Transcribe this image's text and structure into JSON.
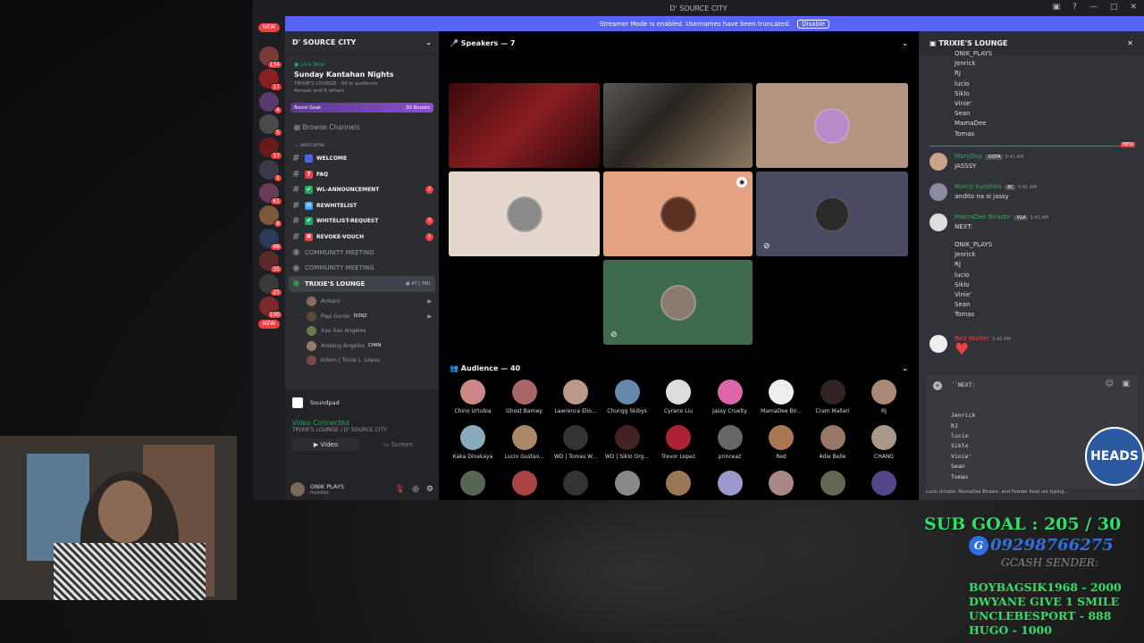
{
  "window": {
    "title": "D' SOURCE CITY"
  },
  "banner": {
    "text": "Streamer Mode is enabled. Usernames have been truncated.",
    "button": "Disable"
  },
  "servers": [
    {
      "badge": "NEW"
    },
    {
      "count": "134"
    },
    {
      "count": "17"
    },
    {
      "count": "4"
    },
    {
      "count": "5"
    },
    {
      "count": "17"
    },
    {
      "count": "1"
    },
    {
      "count": "61"
    },
    {
      "count": "9"
    },
    {
      "count": "48"
    },
    {
      "count": "35"
    },
    {
      "count": "25"
    },
    {
      "count": "100"
    },
    {
      "badge": "NEW"
    }
  ],
  "sidebar": {
    "server_name": "D' SOURCE CITY",
    "event": {
      "live": "Live Now",
      "title": "Sunday Kantahan Nights",
      "lounge": "TRIXIE'S LOUNGE",
      "audience": "40 in audience",
      "others": "Armani and 6 others"
    },
    "boost": {
      "label": "Boost Goal",
      "count": "30 Boosts"
    },
    "browse": "Browse Channels",
    "category": "welcome.",
    "channels": [
      {
        "icon": "🐾",
        "name": "WELCOME",
        "badge": ""
      },
      {
        "icon": "?",
        "name": "FAQ",
        "badge": ""
      },
      {
        "icon": "✔",
        "name": "WL-ANNOUNCEMENT",
        "badge": "2"
      },
      {
        "icon": "✉",
        "name": "REWHITELIST",
        "badge": ""
      },
      {
        "icon": "✔",
        "name": "WHITELIST-REQUEST",
        "badge": "3"
      },
      {
        "icon": "✖",
        "name": "REVOKE-VOUCH",
        "badge": "1"
      }
    ],
    "meetings": [
      "COMMUNITY MEETING",
      "COMMUNITY MEETING"
    ],
    "lounge": {
      "name": "TRIXIE'S LOUNGE",
      "sub": "Sunday Kantahan Nights",
      "count": "47",
      "listeners": "780"
    },
    "users": [
      {
        "name": "Armani",
        "tag": ""
      },
      {
        "name": "Papi Gordo",
        "tag": "DONZ"
      },
      {
        "name": "Xav Xav Angeles",
        "tag": ""
      },
      {
        "name": "Andeng Angeles",
        "tag": "CHRN"
      },
      {
        "name": "Intern | Trixie L. Lopez",
        "tag": ""
      }
    ],
    "soundpad": "Soundpad",
    "voice": {
      "status": "Video Connected",
      "where": "TRIXIE'S LOUNGE / D' SOURCE CITY",
      "video": "Video",
      "screen": "Screen"
    },
    "me": {
      "name": "ONIK PLAYS",
      "status": "Invisible"
    }
  },
  "stage": {
    "speakers_label": "Speakers — 7",
    "audience_label": "Audience — 40",
    "audience": [
      "Chino Urtubia",
      "Ghost Barney",
      "Lawrence Elio...",
      "Chungg Skibys",
      "Cyrano Liu",
      "Jassy Cruelty",
      "MamaDee Bir...",
      "Cram Mallari",
      "RJ",
      "Kaka Dinakaya",
      "Lucio Gustav...",
      "WD | Tomas W...",
      "WD | Siklo Org...",
      "Trevor Lopez",
      "princeaz",
      "Red",
      "Adie Belle",
      "CHANG",
      "",
      "",
      "",
      "",
      "",
      "",
      "",
      "",
      ""
    ]
  },
  "chat": {
    "title": "TRIXIE'S LOUNGE",
    "top_lines": [
      "ONIK_PLAYS",
      "Jenrick",
      "RJ",
      "lucio",
      "Siklo",
      "Vinie'",
      "Sean",
      "MamaDee",
      "Tomas"
    ],
    "new_label": "NEW",
    "messages": [
      {
        "author": "MaryDay",
        "tag": "DOTA",
        "time": "5:41 AM",
        "text": "JASSSY",
        "color": "#3ba55d"
      },
      {
        "author": "Marco kyoshiro",
        "tag": "BC",
        "time": "5:41 AM",
        "text": "andito na si jassy",
        "color": "#3ba55d"
      },
      {
        "author": "MamaDee Birador",
        "tag": "VLA",
        "time": "5:42 AM",
        "text": "NEXT:",
        "color": "#3ba55d"
      },
      {
        "author": "Red Walker",
        "tag": "",
        "time": "5:42 AM",
        "text": "♥",
        "color": "#f23f43"
      }
    ],
    "mama_lines": [
      "ONIK_PLAYS",
      "Jenrick",
      "RJ",
      "lucio",
      "Siklo",
      "Vinie'",
      "Sean",
      "Tomas"
    ],
    "composer": "``NEXT:\n\n\nJenrick\nRJ\nlucio\nSiklo\nVinie'\nSean\nTomas",
    "typing": "Lucio Urtubia, MamaDee Birador, and Powder Kawi are typing..."
  },
  "overlay": {
    "heads": "HEADS",
    "sub_goal": "SUB GOAL : 205 / 30",
    "gcash_number": "09298766275",
    "gcash_sender": "GCASH SENDER:",
    "donors": [
      "BOYBAGSIK1968 - 2000",
      "DWYANE GIVE 1 SMILE",
      "UNCLEBESPORT - 888",
      "HUGO - 1000"
    ]
  },
  "colors": {
    "accent": "#5865f2",
    "online": "#23a55a",
    "danger": "#f23f43",
    "goal_green": "#2ee06a"
  }
}
